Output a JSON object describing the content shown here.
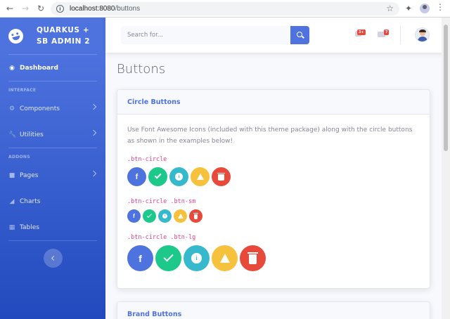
{
  "browser": {
    "url_host": "localhost:8080",
    "url_path": "/buttons"
  },
  "sidebar": {
    "brand": {
      "line1": "QUARKUS +",
      "line2": "SB ADMIN 2"
    },
    "dashboard": "Dashboard",
    "heading_interface": "INTERFACE",
    "components": "Components",
    "utilities": "Utilities",
    "heading_addons": "ADDONS",
    "pages": "Pages",
    "charts": "Charts",
    "tables": "Tables"
  },
  "topbar": {
    "search_placeholder": "Search for...",
    "alerts_badge": "3+",
    "messages_badge": "7"
  },
  "page": {
    "title": "Buttons"
  },
  "card_circle": {
    "header": "Circle Buttons",
    "description": "Use Font Awesome Icons (included with this theme package) along with the circle buttons as shown in the examples below!",
    "code_regular": ".btn-circle",
    "code_small": ".btn-circle .btn-sm",
    "code_large": ".btn-circle .btn-lg",
    "facebook_glyph": "f",
    "info_glyph": "i",
    "warning_glyph": "!"
  },
  "card_brand": {
    "header": "Brand Buttons"
  },
  "colors": {
    "primary": "#4e73df",
    "success": "#1cc88a",
    "info": "#36b9cc",
    "warning": "#f6c23e",
    "danger": "#e74a3b"
  }
}
